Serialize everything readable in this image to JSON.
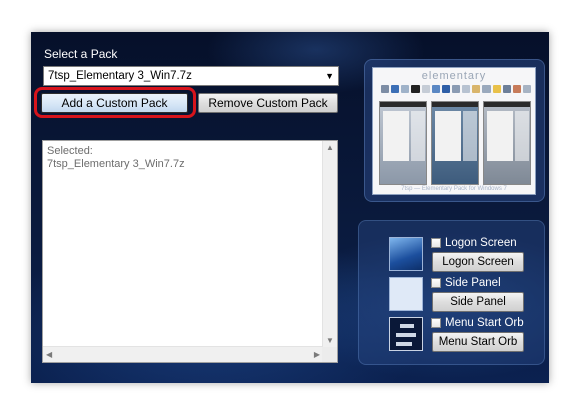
{
  "pack": {
    "select_label": "Select a Pack",
    "selected_value": "7tsp_Elementary 3_Win7.7z",
    "add_button": "Add a Custom Pack",
    "remove_button": "Remove Custom Pack",
    "list_line1": "Selected:",
    "list_line2": "7tsp_Elementary 3_Win7.7z"
  },
  "preview": {
    "title": "elementary",
    "caption": "7tsp — Elementary Pack for Windows 7"
  },
  "options": {
    "logon": {
      "checkbox_label": "Logon Screen",
      "button": "Logon Screen",
      "checked": false
    },
    "side": {
      "checkbox_label": "Side Panel",
      "button": "Side Panel",
      "checked": false
    },
    "orb": {
      "checkbox_label": "Menu Start Orb",
      "button": "Menu Start Orb",
      "checked": false
    }
  },
  "colors": {
    "highlight": "#d7141c",
    "window_bg": "#0a1a3d"
  },
  "icons": [
    "dropdown-arrow-icon",
    "scroll-up-icon",
    "scroll-down-icon",
    "scroll-left-icon",
    "scroll-right-icon"
  ]
}
